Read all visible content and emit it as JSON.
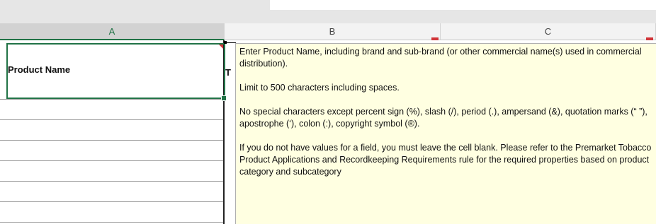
{
  "columns": [
    {
      "letter": "A",
      "selected": true
    },
    {
      "letter": "B",
      "selected": false
    },
    {
      "letter": "C",
      "selected": false
    }
  ],
  "cell_a1": {
    "value": "Product Name"
  },
  "cell_b1_partial": {
    "value": "T"
  },
  "comment": {
    "paragraphs": [
      "Enter Product Name, including brand and sub-brand (or other commercial name(s) used in commercial distribution).",
      "Limit to 500 characters including spaces.",
      "No special characters except percent sign (%), slash (/), period (.), ampersand (&), quotation marks (“ ”), apostrophe (‘), colon (:), copyright symbol (®).",
      "If you do not have values for a field, you must leave the cell blank. Please refer to the Premarket Tobacco Product Applications and Recordkeeping Requirements rule for the required properties based on product category and subcategory"
    ]
  },
  "colors": {
    "selection": "#217346",
    "comment_bg": "#ffffe1",
    "comment_indicator": "#d13438"
  }
}
